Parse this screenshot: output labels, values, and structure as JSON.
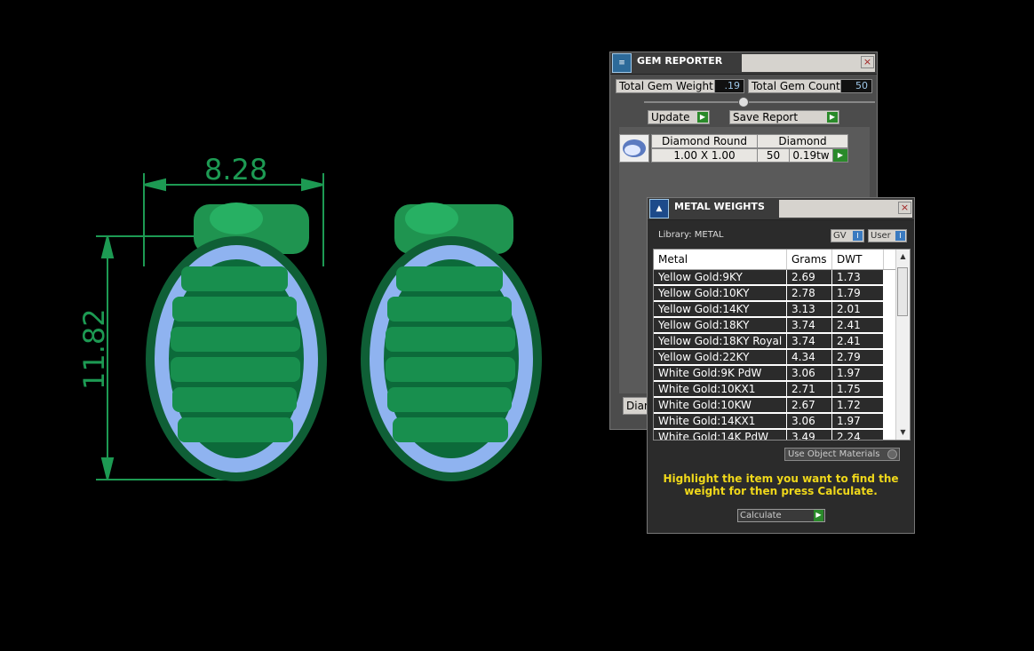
{
  "viewport": {
    "dimensions": {
      "width": "8.28",
      "height": "11.82"
    },
    "colors": {
      "metal": "#1c8a4c",
      "gems": "#8fb3f0",
      "dimension": "#1d9a53"
    }
  },
  "gem_reporter": {
    "title": "GEM REPORTER",
    "close": "×",
    "total_weight_label": "Total Gem Weight",
    "total_weight_value": ".19",
    "total_count_label": "Total Gem Count",
    "total_count_value": "50",
    "update_label": "Update",
    "save_label": "Save Report",
    "gems": [
      {
        "shape": "Diamond Round",
        "type": "Diamond",
        "size": "1.00 X 1.00",
        "count": "50",
        "weight": "0.19tw"
      }
    ],
    "tab_label": "Diam"
  },
  "metal_weights": {
    "title": "METAL WEIGHTS",
    "close": "×",
    "library": "Library: METAL",
    "gv_label": "GV",
    "user_label": "User",
    "columns": [
      "Metal",
      "Grams",
      "DWT"
    ],
    "rows": [
      {
        "metal": "Yellow Gold:9KY",
        "grams": "2.69",
        "dwt": "1.73"
      },
      {
        "metal": "Yellow Gold:10KY",
        "grams": "2.78",
        "dwt": "1.79"
      },
      {
        "metal": "Yellow Gold:14KY",
        "grams": "3.13",
        "dwt": "2.01"
      },
      {
        "metal": "Yellow Gold:18KY",
        "grams": "3.74",
        "dwt": "2.41"
      },
      {
        "metal": "Yellow Gold:18KY Royal",
        "grams": "3.74",
        "dwt": "2.41"
      },
      {
        "metal": "Yellow Gold:22KY",
        "grams": "4.34",
        "dwt": "2.79"
      },
      {
        "metal": "White Gold:9K PdW",
        "grams": "3.06",
        "dwt": "1.97"
      },
      {
        "metal": "White Gold:10KX1",
        "grams": "2.71",
        "dwt": "1.75"
      },
      {
        "metal": "White Gold:10KW",
        "grams": "2.67",
        "dwt": "1.72"
      },
      {
        "metal": "White Gold:14KX1",
        "grams": "3.06",
        "dwt": "1.97"
      },
      {
        "metal": "White Gold:14K PdW",
        "grams": "3.49",
        "dwt": "2.24"
      }
    ],
    "use_object_materials": "Use Object Materials",
    "hint": "Highlight the item you want to find the weight for then press Calculate.",
    "calculate_label": "Calculate"
  }
}
